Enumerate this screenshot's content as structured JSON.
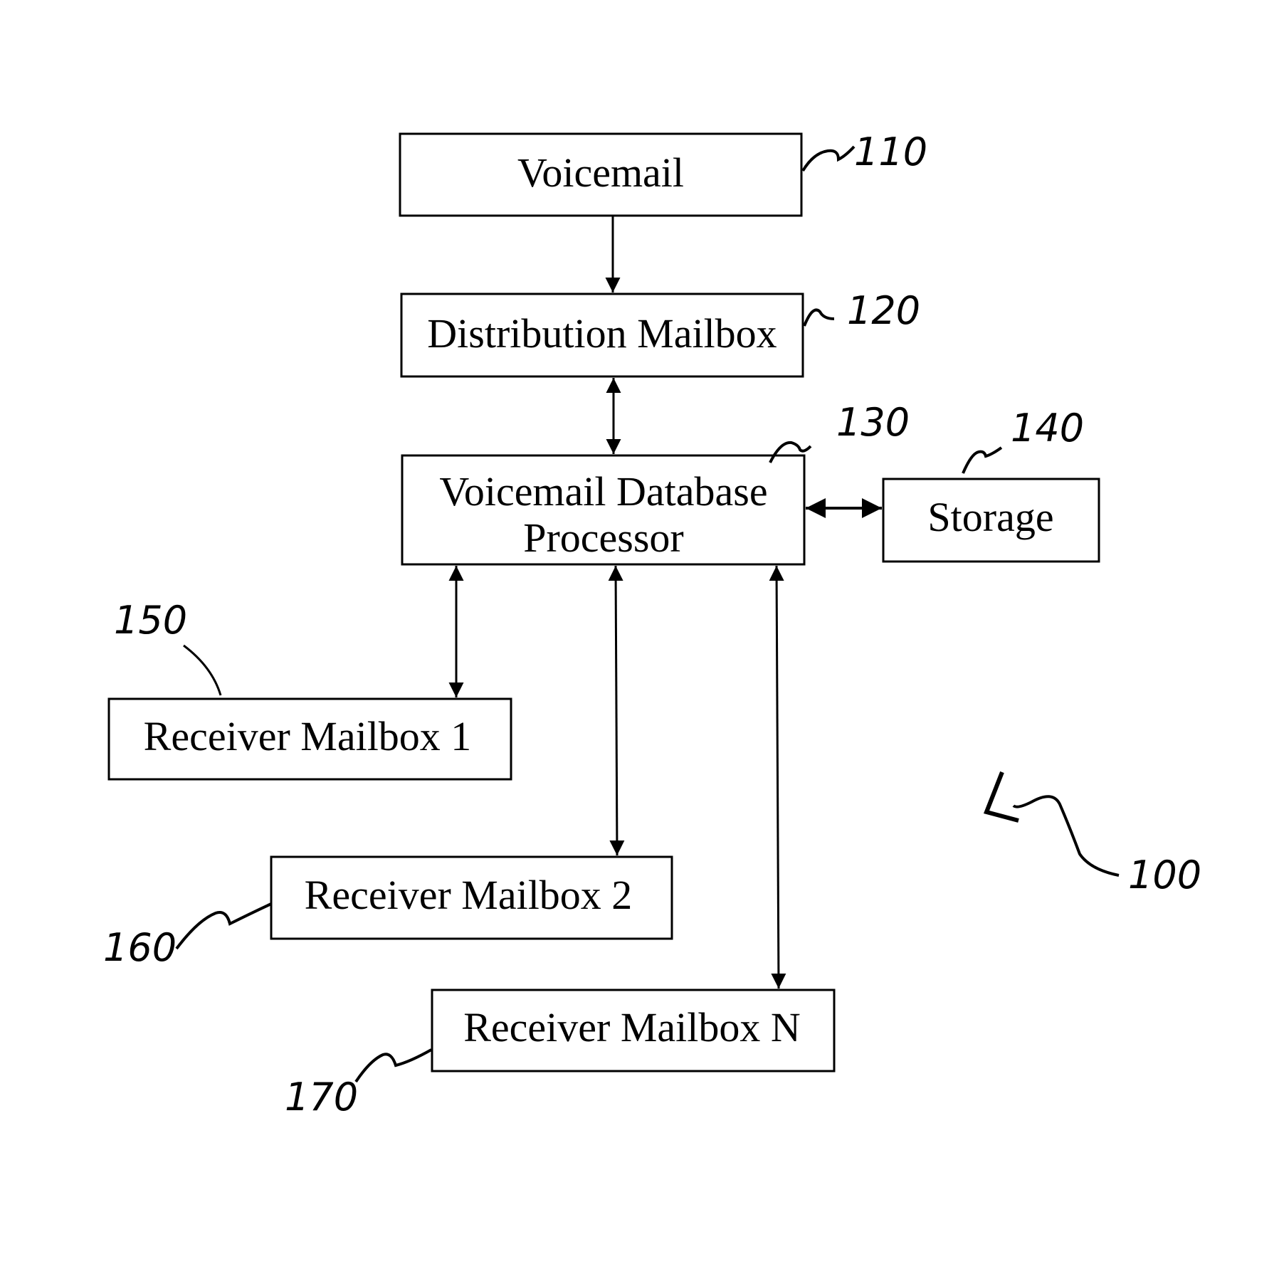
{
  "diagram": {
    "figure_ref": "100",
    "nodes": [
      {
        "id": "voicemail",
        "label": "Voicemail",
        "ref": "110"
      },
      {
        "id": "distribution",
        "label": "Distribution Mailbox",
        "ref": "120"
      },
      {
        "id": "vdp",
        "label_line1": "Voicemail Database",
        "label_line2": "Processor",
        "ref": "130"
      },
      {
        "id": "storage",
        "label": "Storage",
        "ref": "140"
      },
      {
        "id": "rm1",
        "label": "Receiver Mailbox 1",
        "ref": "150"
      },
      {
        "id": "rm2",
        "label": "Receiver Mailbox 2",
        "ref": "160"
      },
      {
        "id": "rmn",
        "label": "Receiver Mailbox N",
        "ref": "170"
      }
    ],
    "edges": [
      {
        "from": "voicemail",
        "to": "distribution",
        "direction": "one-way"
      },
      {
        "from": "distribution",
        "to": "vdp",
        "direction": "two-way"
      },
      {
        "from": "vdp",
        "to": "storage",
        "direction": "two-way"
      },
      {
        "from": "vdp",
        "to": "rm1",
        "direction": "two-way"
      },
      {
        "from": "vdp",
        "to": "rm2",
        "direction": "two-way"
      },
      {
        "from": "vdp",
        "to": "rmn",
        "direction": "two-way"
      }
    ]
  }
}
